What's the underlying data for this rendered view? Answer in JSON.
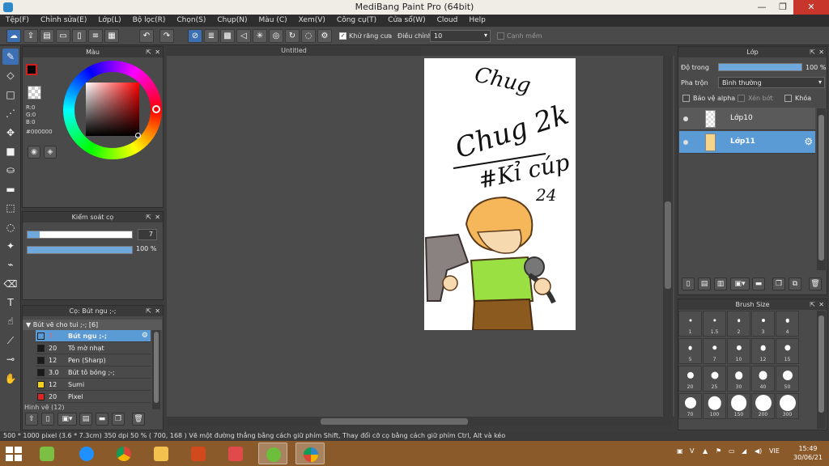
{
  "window": {
    "title": "MediBang Paint Pro (64bit)",
    "min": "—",
    "max": "❐",
    "close": "✕"
  },
  "menu": [
    "Tệp(F)",
    "Chỉnh sửa(E)",
    "Lớp(L)",
    "Bộ lọc(R)",
    "Chọn(S)",
    "Chụp(N)",
    "Màu (C)",
    "Xem(V)",
    "Công cụ(T)",
    "Cửa sổ(W)",
    "Cloud",
    "Help"
  ],
  "toolbar": {
    "antialias_label": "Khử răng cưa",
    "correction_label": "Điều chỉnh",
    "correction_value": "10",
    "edge_label": "Cạnh mềm"
  },
  "color_panel": {
    "title": "Màu",
    "r": "R:0",
    "g": "G:0",
    "b": "B:0",
    "hex": "#000000",
    "fg": "#000000",
    "bg": "#ffffff"
  },
  "brush_control": {
    "title": "Kiểm soát cọ",
    "size_value": "7",
    "size_fraction": 0.12,
    "opacity_value": "100 %",
    "opacity_fraction": 1.0
  },
  "brush_panel": {
    "title": "Cọ: Bút ngu ;-;",
    "group_label": "Bút vẽ cho tui ;-; [6]",
    "next_group_label": "Hình vẽ (12)",
    "brushes": [
      {
        "size": "7",
        "name": "Bút ngu ;-;",
        "color": "#5b9bd5",
        "selected": true
      },
      {
        "size": "20",
        "name": "Tô mờ nhạt",
        "color": "#1a1a1a",
        "selected": false
      },
      {
        "size": "12",
        "name": "Pen (Sharp)",
        "color": "#1a1a1a",
        "selected": false
      },
      {
        "size": "3.0",
        "name": "Bút tô bóng ;-;",
        "color": "#1a1a1a",
        "selected": false
      },
      {
        "size": "12",
        "name": "Sumi",
        "color": "#f2d11b",
        "selected": false
      },
      {
        "size": "20",
        "name": "Pixel",
        "color": "#e02525",
        "selected": false
      }
    ]
  },
  "canvas": {
    "tab_title": "Untitled",
    "text_signature": "Chug",
    "text_main": "Chug 2k",
    "text_hashtag": "#Kỉ cúp",
    "text_year": "24"
  },
  "layer_panel": {
    "title": "Lớp",
    "opacity_label": "Độ trong",
    "opacity_value": "100 %",
    "opacity_fraction": 1.0,
    "blend_label": "Pha trộn",
    "blend_value": "Bình thường",
    "protect_alpha": "Bảo vệ alpha",
    "clipping": "Xén bớt",
    "lock": "Khóa",
    "layers": [
      {
        "name": "Lớp10",
        "selected": false
      },
      {
        "name": "Lớp11",
        "selected": true
      }
    ]
  },
  "brush_size_panel": {
    "title": "Brush Size",
    "sizes": [
      "1",
      "1.5",
      "2",
      "3",
      "4",
      "5",
      "7",
      "10",
      "12",
      "15",
      "20",
      "25",
      "30",
      "40",
      "50",
      "70",
      "100",
      "150",
      "200",
      "300"
    ]
  },
  "status": {
    "text": "500 * 1000 pixel   (3.6 * 7.3cm)   350 dpi   50 %   ( 700, 168 )   Vẽ một đường thẳng bằng cách giữ phím Shift, Thay đổi cỡ cọ bằng cách giữ phím Ctrl, Alt và kéo"
  },
  "taskbar": {
    "lang": "VIE",
    "time": "15:49",
    "date": "30/06/21"
  }
}
